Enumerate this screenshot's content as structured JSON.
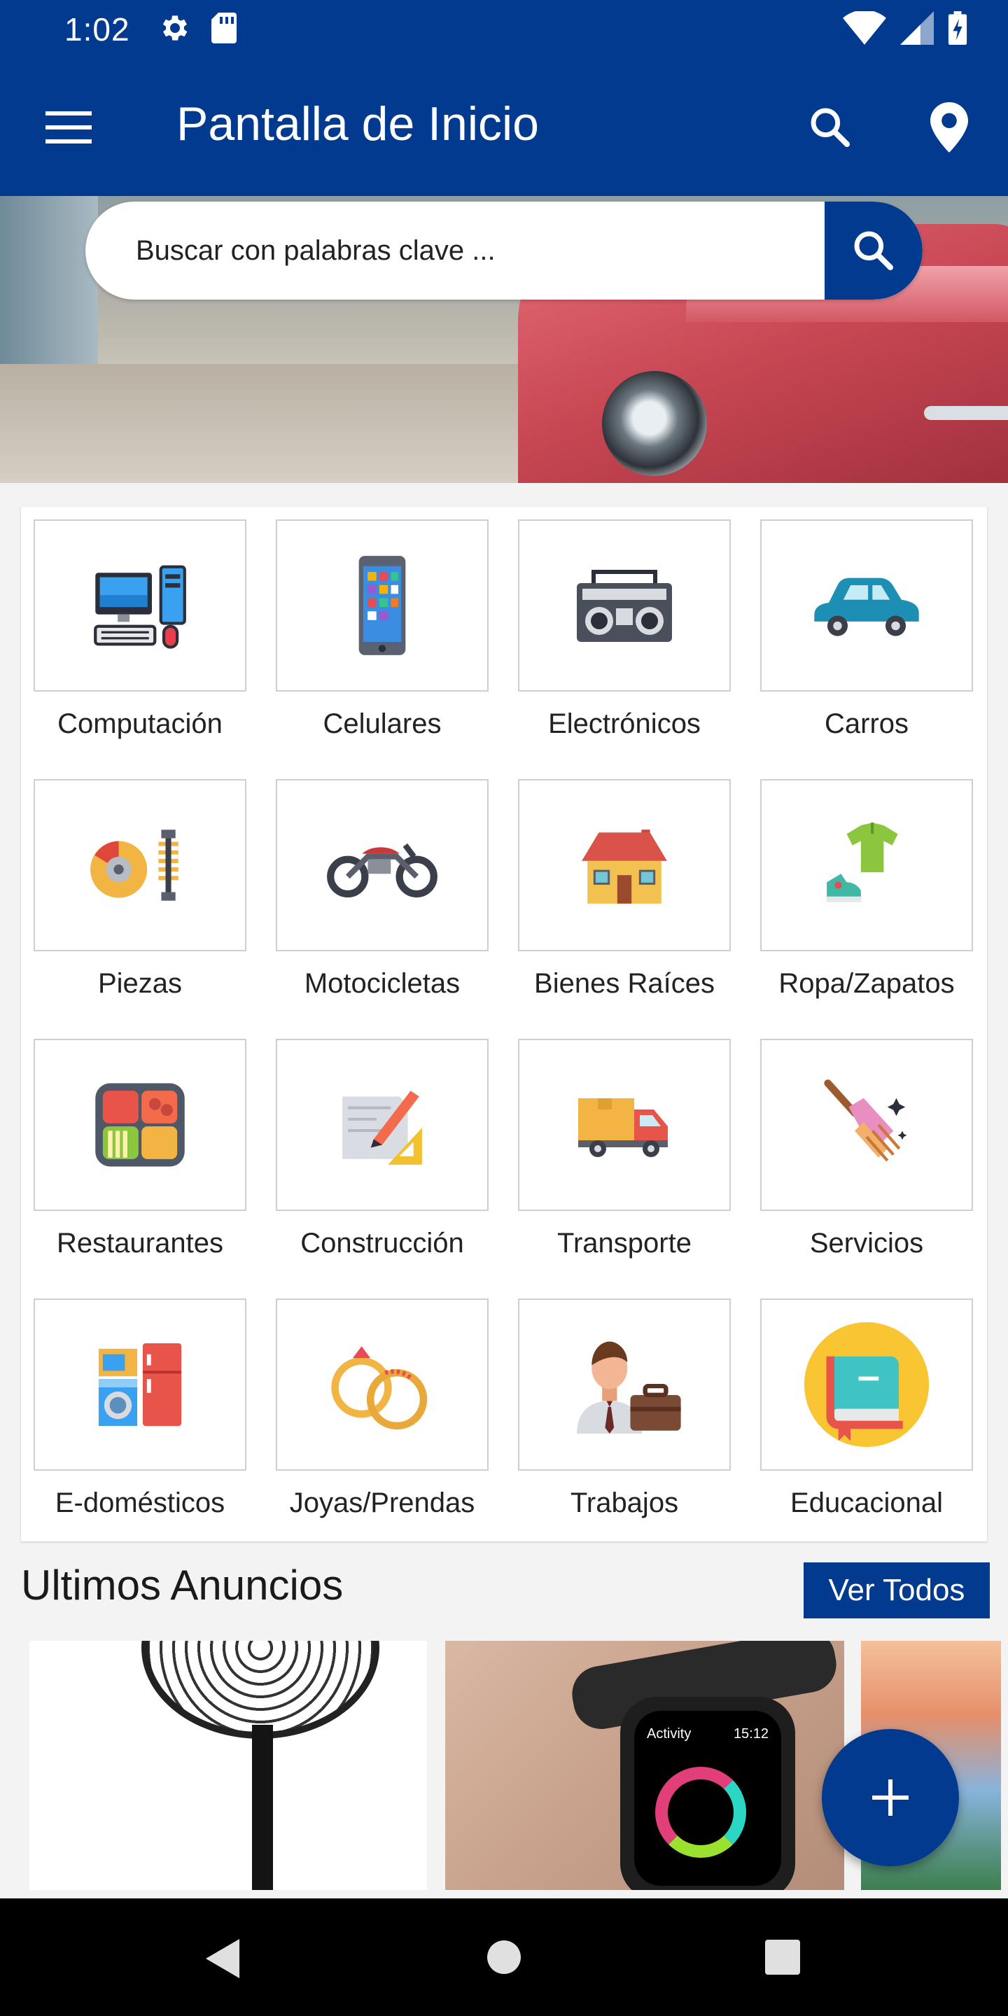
{
  "status_bar": {
    "time": "1:02",
    "left_icons": [
      "gear-icon",
      "sd-card-icon"
    ],
    "right_icons": [
      "wifi-icon",
      "signal-icon",
      "battery-icon"
    ]
  },
  "app_bar": {
    "title": "Pantalla de Inicio",
    "icons": [
      "menu-icon",
      "search-icon",
      "location-pin-icon"
    ]
  },
  "search": {
    "placeholder": "Buscar con palabras clave ..."
  },
  "categories": [
    {
      "label": "Computación",
      "icon": "computer-icon"
    },
    {
      "label": "Celulares",
      "icon": "smartphone-icon"
    },
    {
      "label": "Electrónicos",
      "icon": "boombox-icon"
    },
    {
      "label": "Carros",
      "icon": "car-icon"
    },
    {
      "label": "Piezas",
      "icon": "car-parts-icon"
    },
    {
      "label": "Motocicletas",
      "icon": "motorcycle-icon"
    },
    {
      "label": "Bienes Raíces",
      "icon": "house-icon"
    },
    {
      "label": "Ropa/Zapatos",
      "icon": "clothes-icon"
    },
    {
      "label": "Restaurantes",
      "icon": "food-tray-icon"
    },
    {
      "label": "Construcción",
      "icon": "blueprint-icon"
    },
    {
      "label": "Transporte",
      "icon": "truck-icon"
    },
    {
      "label": "Servicios",
      "icon": "broom-icon"
    },
    {
      "label": "E-domésticos",
      "icon": "appliances-icon"
    },
    {
      "label": "Joyas/Prendas",
      "icon": "rings-icon"
    },
    {
      "label": "Trabajos",
      "icon": "businessman-icon"
    },
    {
      "label": "Educacional",
      "icon": "book-icon"
    }
  ],
  "latest": {
    "title": "Ultimos Anuncios",
    "see_all": "Ver Todos",
    "ads": [
      {
        "image": "standing-fan"
      },
      {
        "image": "smartwatch",
        "watch_text": "Activity",
        "watch_time": "15:12"
      },
      {
        "image": "landscape"
      }
    ]
  },
  "colors": {
    "primary": "#013a8f",
    "background": "#f3f3f3"
  }
}
